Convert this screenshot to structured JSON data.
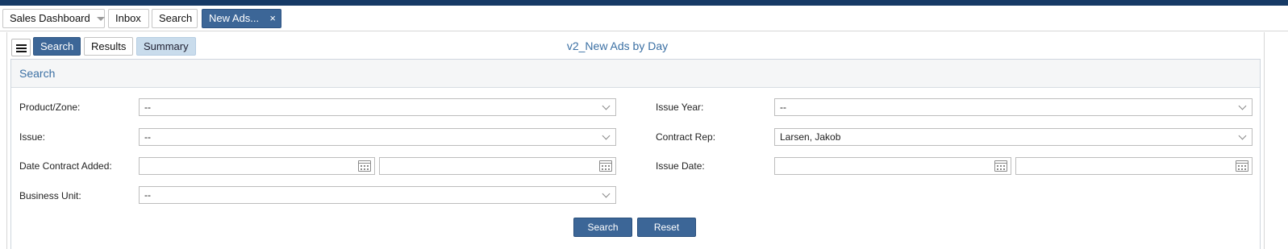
{
  "tabs": [
    {
      "label": "Sales Dashboard",
      "has_dropdown": true
    },
    {
      "label": "Inbox"
    },
    {
      "label": "Search"
    },
    {
      "label": "New Ads...",
      "active": true,
      "closable": true
    }
  ],
  "close_glyph": "×",
  "toolbar": {
    "menu_icon": "hamburger-menu-icon",
    "views": [
      "Search",
      "Results",
      "Summary"
    ],
    "report_title": "v2_New Ads by Day"
  },
  "search_panel": {
    "title": "Search",
    "left_fields": [
      {
        "label": "Product/Zone:",
        "type": "select",
        "value": "--"
      },
      {
        "label": "Issue:",
        "type": "select",
        "value": "--"
      },
      {
        "label": "Date Contract Added:",
        "type": "date-range",
        "from": "",
        "to": ""
      },
      {
        "label": "Business Unit:",
        "type": "select",
        "value": "--"
      }
    ],
    "right_fields": [
      {
        "label": "Issue Year:",
        "type": "select",
        "value": "--"
      },
      {
        "label": "Contract Rep:",
        "type": "select",
        "value": "Larsen, Jakob"
      },
      {
        "label": "Issue Date:",
        "type": "date-range",
        "from": "",
        "to": ""
      }
    ],
    "buttons": {
      "search": "Search",
      "reset": "Reset"
    }
  },
  "colors": {
    "accent": "#3c6697",
    "top_bar": "#163a66",
    "title_text": "#3a6fa3",
    "summary_tab_bg": "#c9dcec"
  }
}
